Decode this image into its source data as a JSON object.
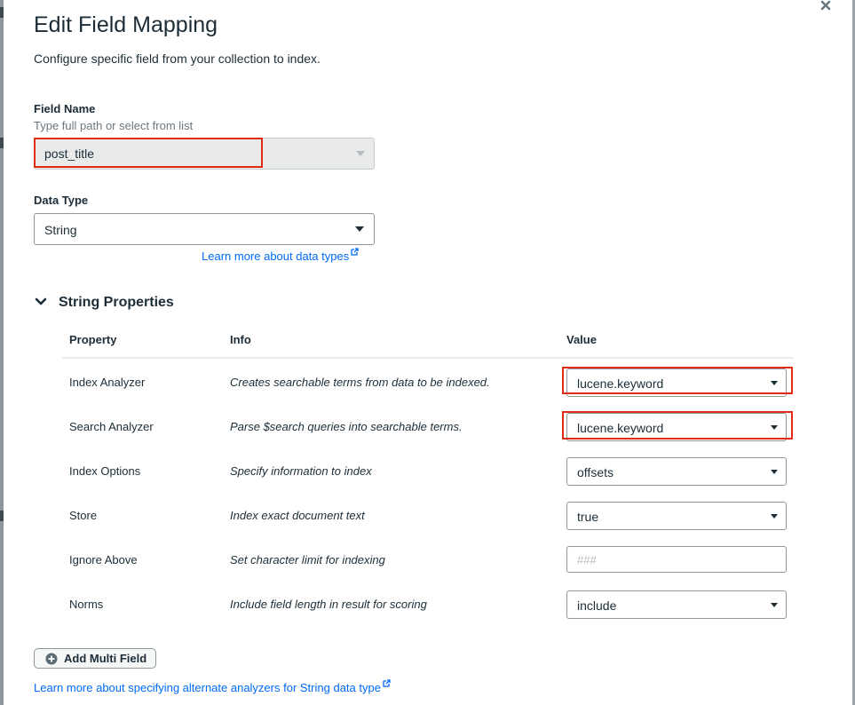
{
  "dialog": {
    "title": "Edit Field Mapping",
    "subtitle": "Configure specific field from your collection to index.",
    "close_icon": "close-icon"
  },
  "field_name": {
    "label": "Field Name",
    "hint": "Type full path or select from list",
    "value": "post_title"
  },
  "data_type": {
    "label": "Data Type",
    "value": "String",
    "learn_more": "Learn more about data types"
  },
  "string_properties": {
    "title": "String Properties",
    "columns": [
      "Property",
      "Info",
      "Value"
    ],
    "rows": [
      {
        "property": "Index Analyzer",
        "info": "Creates searchable terms from data to be indexed.",
        "value": "lucene.keyword",
        "highlighted": true
      },
      {
        "property": "Search Analyzer",
        "info": "Parse $search queries into searchable terms.",
        "value": "lucene.keyword",
        "highlighted": true
      },
      {
        "property": "Index Options",
        "info": "Specify information to index",
        "value": "offsets"
      },
      {
        "property": "Store",
        "info": "Index exact document text",
        "value": "true"
      },
      {
        "property": "Ignore Above",
        "info": "Set character limit for indexing",
        "value": "",
        "placeholder": "###"
      },
      {
        "property": "Norms",
        "info": "Include field length in result for scoring",
        "value": "include"
      }
    ]
  },
  "add_multi_field": "Add Multi Field",
  "footer_link": "Learn more about specifying alternate analyzers for String data type",
  "colors": {
    "link": "#016bf8",
    "highlight": "#e22b14",
    "text": "#1c2d38"
  }
}
